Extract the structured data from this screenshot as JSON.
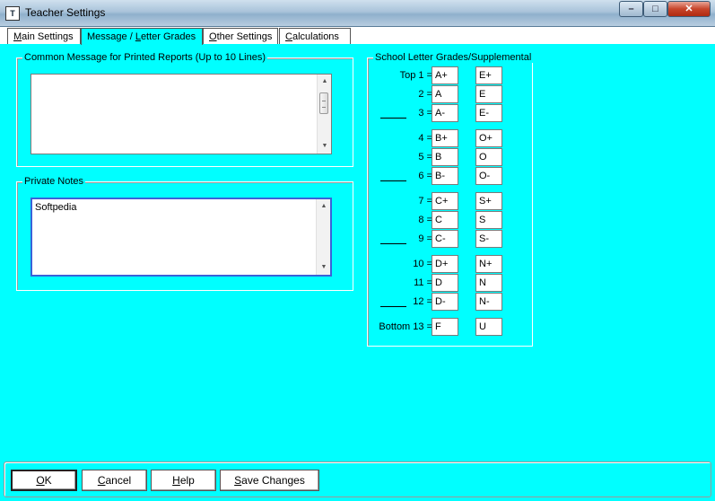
{
  "window": {
    "title": "Teacher Settings",
    "icon_name": "teacher-app-icon",
    "controls": {
      "minimize": "–",
      "maximize": "□",
      "close": "✕"
    }
  },
  "tabs": [
    {
      "label": "Main Settings",
      "accel": "M",
      "active": false
    },
    {
      "label": "Message / Letter Grades",
      "accel": "L",
      "active": true
    },
    {
      "label": "Other Settings",
      "accel": "O",
      "active": false
    },
    {
      "label": "Calculations",
      "accel": "C",
      "active": false
    }
  ],
  "common_message": {
    "label": "Common Message for Printed Reports (Up to 10 Lines)",
    "value": ""
  },
  "private_notes": {
    "label": "Private Notes",
    "value": "Softpedia"
  },
  "grades": {
    "title": "School Letter Grades/Supplemental",
    "rows": [
      {
        "label": "Top   1 =",
        "blank": false,
        "grade": "A+",
        "supplemental": "E+"
      },
      {
        "label": "2 =",
        "blank": false,
        "grade": "A",
        "supplemental": "E"
      },
      {
        "label": "3 =",
        "blank": true,
        "grade": "A-",
        "supplemental": "E-"
      },
      {
        "label": "4 =",
        "blank": false,
        "grade": "B+",
        "supplemental": "O+"
      },
      {
        "label": "5 =",
        "blank": false,
        "grade": "B",
        "supplemental": "O"
      },
      {
        "label": "6 =",
        "blank": true,
        "grade": "B-",
        "supplemental": "O-"
      },
      {
        "label": "7 =",
        "blank": false,
        "grade": "C+",
        "supplemental": "S+"
      },
      {
        "label": "8 =",
        "blank": false,
        "grade": "C",
        "supplemental": "S"
      },
      {
        "label": "9 =",
        "blank": true,
        "grade": "C-",
        "supplemental": "S-"
      },
      {
        "label": "10 =",
        "blank": false,
        "grade": "D+",
        "supplemental": "N+"
      },
      {
        "label": "11 =",
        "blank": false,
        "grade": "D",
        "supplemental": "N"
      },
      {
        "label": "12 =",
        "blank": true,
        "grade": "D-",
        "supplemental": "N-"
      },
      {
        "label": "Bottom 13 =",
        "blank": false,
        "grade": "F",
        "supplemental": "U"
      }
    ]
  },
  "buttons": {
    "ok": "OK",
    "cancel": "Cancel",
    "help": "Help",
    "save": "Save Changes"
  },
  "colors": {
    "background": "#00ffff",
    "focus_border": "#3a62d8"
  }
}
